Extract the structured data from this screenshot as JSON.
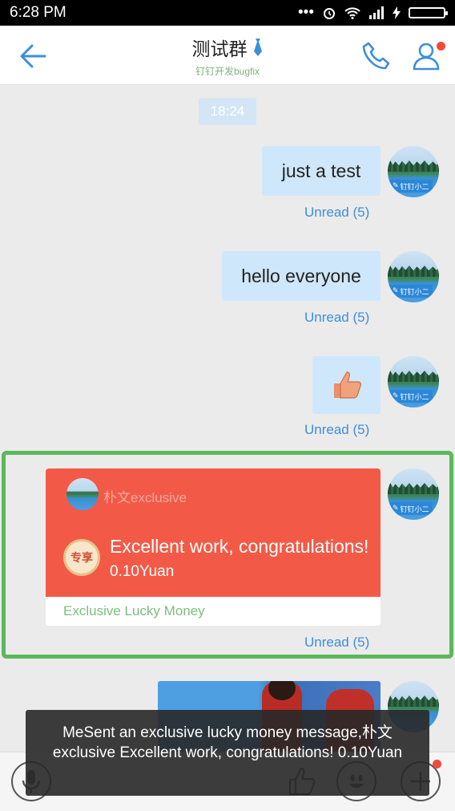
{
  "status_bar": {
    "time": "6:28 PM"
  },
  "header": {
    "title": "测试群",
    "subtitle": "钉钉开发bugfix"
  },
  "chat": {
    "timestamp": "18:24",
    "avatar_tag": "钉钉小二",
    "messages": [
      {
        "text": "just a test",
        "unread": "Unread (5)"
      },
      {
        "text": "hello everyone",
        "unread": "Unread (5)"
      },
      {
        "text": "",
        "unread": "Unread (5)"
      }
    ],
    "lucky_money": {
      "sender": "朴文exclusive",
      "seal": "专享",
      "title": "Excellent work, congratulations!",
      "amount": "0.10Yuan",
      "footer": "Exclusive Lucky Money",
      "unread": "Unread (5)"
    }
  },
  "toast": {
    "text": "MeSent an exclusive lucky money message,朴文exclusive Excellent work, congratulations! 0.10Yuan"
  },
  "colors": {
    "accent": "#3b8fdc",
    "lucky_red": "#f25a47",
    "highlight_green": "#5cb85c",
    "bubble": "#cfe7fa"
  }
}
